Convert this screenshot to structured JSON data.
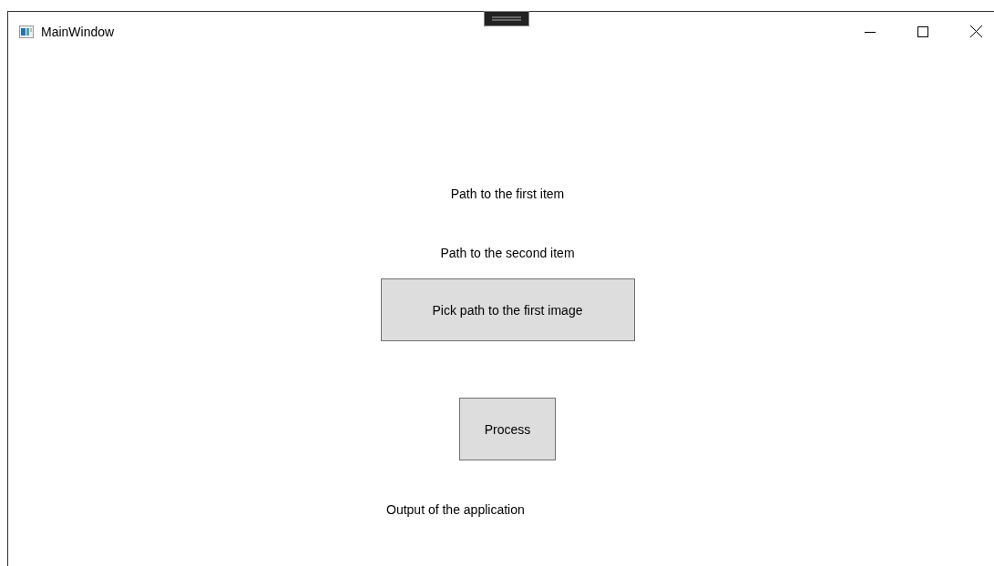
{
  "window": {
    "title": "MainWindow"
  },
  "labels": [
    {
      "kind": "label",
      "text": "Path to the first item"
    },
    {
      "kind": "label",
      "text": "Path to the second item"
    },
    {
      "kind": "button",
      "text": "Pick path to the first image"
    },
    {
      "kind": "button",
      "text": "Process"
    },
    {
      "kind": "output",
      "text": "Output of the application"
    }
  ]
}
